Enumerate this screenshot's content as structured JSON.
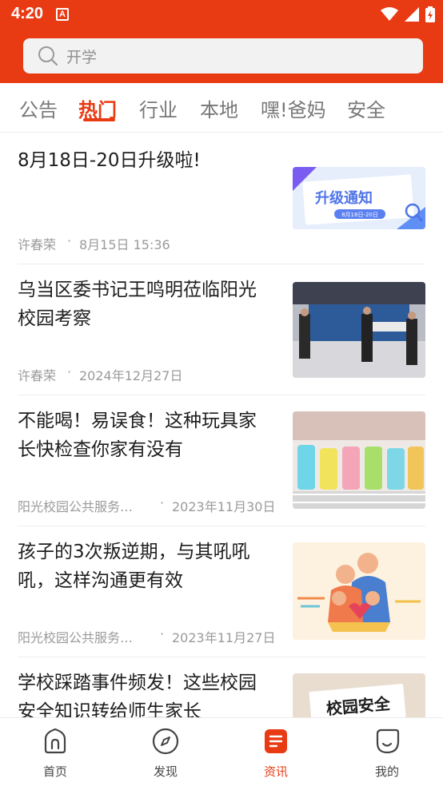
{
  "status_bar": {
    "time": "4:20",
    "app_badge": "A"
  },
  "search": {
    "placeholder": "开学"
  },
  "tabs": [
    {
      "label": "公告",
      "active": false
    },
    {
      "label": "热门",
      "active": true
    },
    {
      "label": "行业",
      "active": false
    },
    {
      "label": "本地",
      "active": false
    },
    {
      "label": "嘿!爸妈",
      "active": false
    },
    {
      "label": "安全",
      "active": false
    }
  ],
  "articles": [
    {
      "title": "8月18日-20日升级啦!",
      "source": "许春荣",
      "date": "8月15日 15:36",
      "thumb_text": "升级通知",
      "thumb_sub": "8月18日-20日"
    },
    {
      "title": "乌当区委书记王鸣明莅临阳光校园考察",
      "source": "许春荣",
      "date": "2024年12月27日"
    },
    {
      "title": "不能喝！易误食！这种玩具家长快检查你家有没有",
      "source": "阳光校园公共服务…",
      "date": "2023年11月30日"
    },
    {
      "title": "孩子的3次叛逆期，与其吼吼吼，这样沟通更有效",
      "source": "阳光校园公共服务…",
      "date": "2023年11月27日"
    },
    {
      "title": "学校踩踏事件频发！这些校园安全知识转给师生家长",
      "thumb_text": "校园安全"
    }
  ],
  "bottom_nav": [
    {
      "label": "首页",
      "icon": "home-icon",
      "active": false
    },
    {
      "label": "发现",
      "icon": "compass-icon",
      "active": false
    },
    {
      "label": "资讯",
      "icon": "news-icon",
      "active": true
    },
    {
      "label": "我的",
      "icon": "profile-icon",
      "active": false
    }
  ],
  "colors": {
    "brand": "#e83b14",
    "text": "#1e1e1e",
    "muted": "#9a9a9a"
  }
}
